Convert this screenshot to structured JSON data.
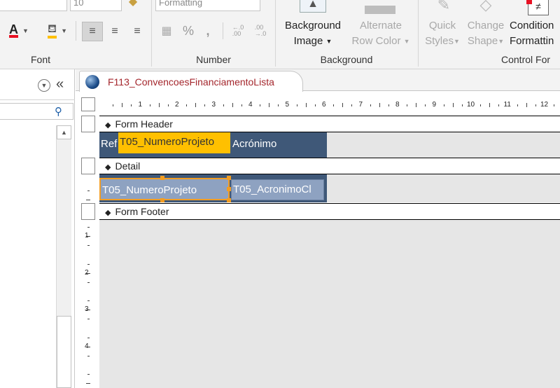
{
  "ribbon": {
    "font_size_value": "10",
    "number_format_value": "Formatting",
    "groups": {
      "font": "Font",
      "number": "Number",
      "background": "Background",
      "control_formatting": "Control For"
    },
    "buttons": {
      "background_image": [
        "Background",
        "Image"
      ],
      "alternate_row_color": [
        "Alternate",
        "Row Color"
      ],
      "quick_styles": [
        "Quick",
        "Styles"
      ],
      "change_shape": [
        "Change",
        "Shape"
      ],
      "conditional_formatting": [
        "Condition",
        "Formattin"
      ]
    },
    "number_symbols": {
      "percent": "%",
      "comma": ",",
      "increase_decimals": "←.0\n.00",
      "decrease_decimals": ".00\n→.0"
    },
    "colors": {
      "font_color": "#e81123",
      "fill_color": "#ffc000"
    }
  },
  "navpane": {
    "collapse_glyph": "«"
  },
  "document": {
    "tab_title": "F113_ConvencoesFinanciamentoLista",
    "sections": {
      "header": "Form Header",
      "detail": "Detail",
      "footer": "Form Footer"
    },
    "header_controls": {
      "label_ref": "Ref",
      "label_numero": "T05_NumeroProjeto",
      "label_acronimo": "Acrónimo"
    },
    "detail_controls": {
      "txt_numero": "T05_NumeroProjeto",
      "txt_acronimo": "T05_AcronimoCl"
    },
    "ruler_h": [
      "1",
      "2",
      "3",
      "4",
      "5",
      "6",
      "7",
      "8",
      "9",
      "10",
      "11",
      "12"
    ],
    "ruler_v": [
      "1",
      "2",
      "3",
      "4"
    ],
    "colors": {
      "section_dark": "#3f5878",
      "selection": "#f29d22",
      "selected_label_bg": "#ffc000",
      "tab_title": "#a4262c"
    }
  }
}
